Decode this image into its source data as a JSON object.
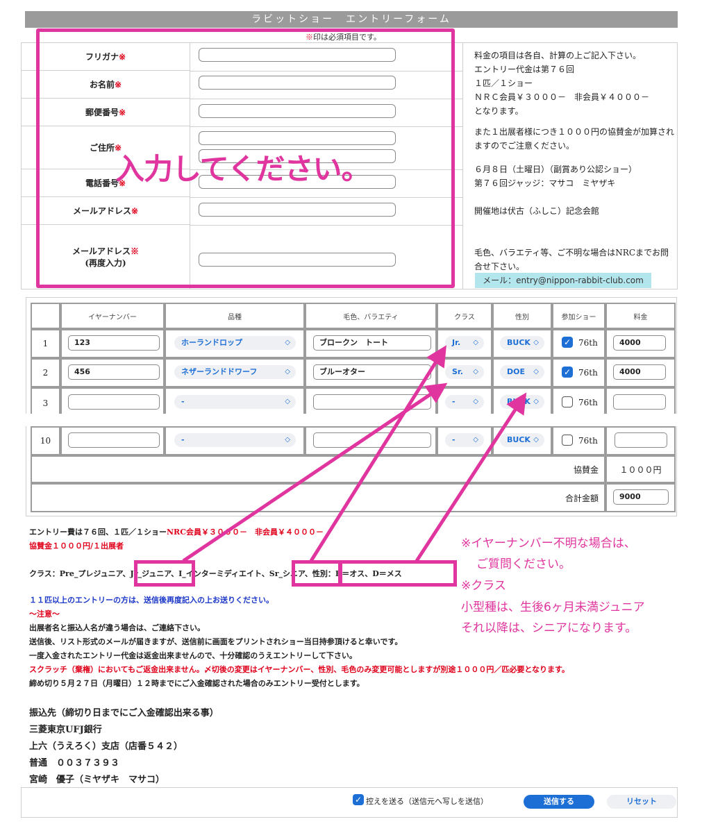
{
  "header": {
    "title": "ラビットショー　エントリーフォーム"
  },
  "required_note": {
    "mark": "※",
    "text": "印は必須項目です。"
  },
  "form": {
    "fields": [
      {
        "label": "フリガナ",
        "req": "※"
      },
      {
        "label": "お名前",
        "req": "※"
      },
      {
        "label": "郵便番号",
        "req": "※"
      },
      {
        "label": "ご住所",
        "req": "※"
      },
      {
        "label": "電話番号",
        "req": "※"
      },
      {
        "label": "メールアドレス",
        "req": "※"
      },
      {
        "label": "メールアドレス",
        "req": "※",
        "sub": "(再度入力)"
      }
    ]
  },
  "info": {
    "p1": "料金の項目は各自、計算の上ご記入下さい。\nエントリー代金は第７６回\n１匹／１ショー\nＮＲＣ会員￥３０００－　非会員￥４０００－\nとなります。",
    "p2": "また１出展者様につき１０００円の協賛金が加算されますのでご注意ください。",
    "p3": "６月８日（土曜日）（副賞あり公認ショー）\n第７６回ジャッジ：マサコ　ミヤザキ",
    "p4": "開催地は伏古（ふしこ）記念会館",
    "p5": "毛色、バラエティ等、ご不明な場合はNRCまでお問合せ下さい。",
    "email": "メール：entry@nippon-rabbit-club.com"
  },
  "overlay": {
    "main": "入力してください。"
  },
  "table": {
    "headers": [
      "",
      "イヤーナンバー",
      "品種",
      "毛色、バラエティ",
      "クラス",
      "性別",
      "参加ショー",
      "料金"
    ],
    "rows": [
      {
        "no": "1",
        "ear": "123",
        "breed": "ホーランドロップ",
        "color": "ブロークン　トート",
        "cls": "Jr.",
        "sex": "BUCK",
        "show": "76th",
        "fee": "4000"
      },
      {
        "no": "2",
        "ear": "456",
        "breed": "ネザーランドドワーフ",
        "color": "ブルーオター",
        "cls": "Sr.",
        "sex": "DOE",
        "show": "76th",
        "fee": "4000"
      },
      {
        "no": "3",
        "ear": "",
        "breed": "-",
        "color": "",
        "cls": "-",
        "sex": "BUCK",
        "show": "76th",
        "fee": ""
      },
      {
        "no": "10",
        "ear": "",
        "breed": "-",
        "color": "",
        "cls": "-",
        "sex": "BUCK",
        "show": "76th",
        "fee": ""
      }
    ],
    "sponsor_label": "協賛金",
    "sponsor_value": "１０００円",
    "total_label": "合計金額",
    "total_value": "9000",
    "chevron": "◇"
  },
  "notes": {
    "fee_a": "エントリー費は７６回、１匹／１ショー",
    "fee_b": "NRC会員￥３０００－　非会員￥４０００－",
    "sponsor": "協賛金１０００円/１出展者",
    "class_a": "クラス：Pre_プレジュニア、",
    "class_jr": "Jr_ジュニア、",
    "class_i": "I_インターミディエイト、",
    "class_sr": "Sr_シニア",
    "class_sex": "性別：B＝オス、D＝メス",
    "over11": "１１匹以上のエントリーの方は、送信後再度記入の上お送りください。",
    "caution": "～注意～",
    "c1": "出展者名と振込人名が違う場合は、ご連絡下さい。",
    "c2": "送信後、リスト形式のメールが届きますが、送信前に画面をプリントされショー当日持参頂けると幸いです。",
    "c3": "一度入金されたエントリー代金は返金出来ませんので、十分確認のうえエントリーして下さい。",
    "c4": "スクラッチ（棄権）においてもご返金出来ません。〆切後の変更はイヤーナンバー、性別、毛色のみ変更可能としますが別途１０００円／匹必要となります。",
    "c5": "締め切り５月２７日（月曜日）１２時までにご入金確認された場合のみエントリー受付とします。",
    "bank_title": "振込先（締切り日までにご入金確認出来る事）",
    "bank1": "三菱東京UFJ銀行",
    "bank2": "上六（うえろく）支店（店番５４２）",
    "bank3": "普通　００３７３９３",
    "bank4": "宮崎　優子（ミヤザキ　マサコ）"
  },
  "annotation": {
    "l1": "※イヤーナンバー不明な場合は、",
    "l2": "ご質問ください。",
    "l3": "※クラス",
    "l4": "小型種は、生後6ヶ月未満ジュニア",
    "l5": "それ以降は、シニアになります。"
  },
  "footer": {
    "copy_label": "控えを送る（送信元へ写しを送信）",
    "submit": "送信する",
    "reset": "リセット"
  },
  "colors": {
    "accent_pink": "#e0359e",
    "required_red": "#e0001b",
    "ios_blue": "#1d6fd6"
  }
}
